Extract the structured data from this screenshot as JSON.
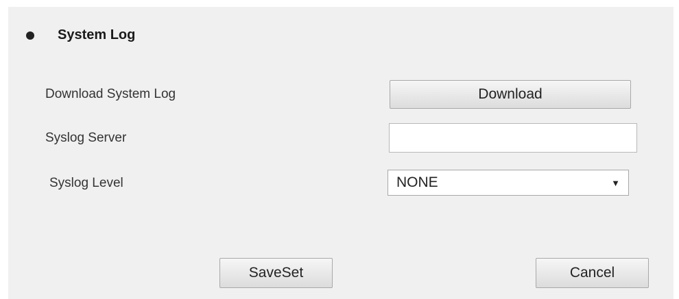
{
  "section": {
    "title": "System Log"
  },
  "form": {
    "download_label": "Download System Log",
    "download_button": "Download",
    "server_label": "Syslog Server",
    "server_value": "",
    "server_placeholder": "",
    "level_label": "Syslog Level",
    "level_value": "NONE"
  },
  "actions": {
    "save_label": "SaveSet",
    "cancel_label": "Cancel"
  },
  "icons": {
    "bullet": "bullet-icon",
    "dropdown": "dropdown-arrow-icon"
  }
}
